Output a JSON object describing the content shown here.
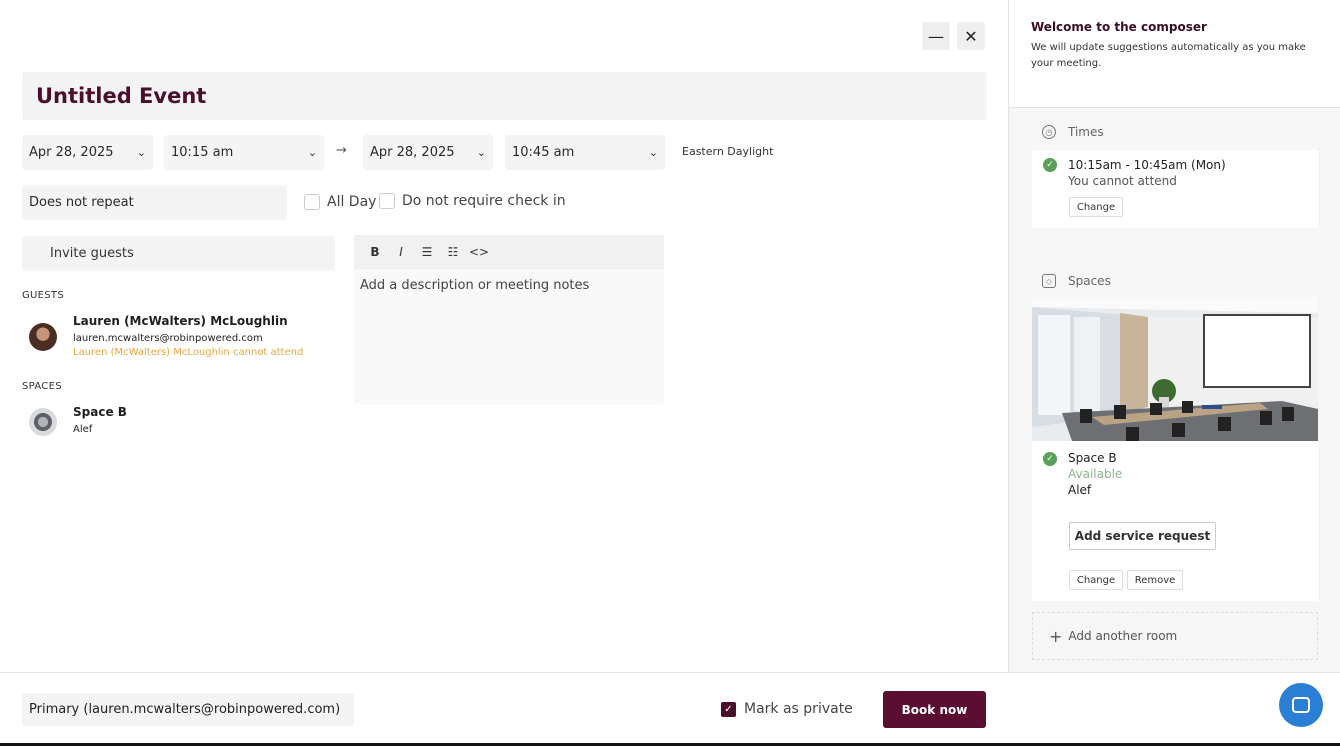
{
  "window": {
    "minimize_icon": "minimize-icon",
    "close_icon": "close-icon"
  },
  "event": {
    "title": "Untitled Event",
    "start_date": "Apr 28, 2025",
    "start_time": "10:15 am",
    "arrow": "→",
    "end_date": "Apr 28, 2025",
    "end_time": "10:45 am",
    "timezone": "Eastern Daylight",
    "repeat": "Does not repeat",
    "all_day_label": "All Day",
    "checkin_label": "Do not require check in",
    "invite_placeholder": "Invite guests",
    "description_placeholder": "Add a description or meeting notes"
  },
  "toolbar": {
    "bold": "B",
    "italic": "I",
    "code": "<>"
  },
  "guests": {
    "heading": "GUESTS",
    "items": [
      {
        "name": "Lauren (McWalters) McLoughlin",
        "email": "lauren.mcwalters@robinpowered.com",
        "warning": "Lauren (McWalters) McLoughlin cannot attend"
      }
    ]
  },
  "spaces": {
    "heading": "SPACES",
    "items": [
      {
        "name": "Space B",
        "location": "Alef"
      }
    ]
  },
  "footer": {
    "calendar": "Primary (lauren.mcwalters@robinpowered.com)",
    "private_label": "Mark as private",
    "private_checked": true,
    "book_label": "Book now"
  },
  "sidebar": {
    "welcome_title": "Welcome to the composer",
    "welcome_text": "We will update suggestions automatically as you make your meeting.",
    "times": {
      "heading": "Times",
      "range": "10:15am - 10:45am (Mon)",
      "note": "You cannot attend",
      "change_label": "Change"
    },
    "spaces": {
      "heading": "Spaces",
      "name": "Space B",
      "status": "Available",
      "location": "Alef",
      "service_label": "Add service request",
      "change_label": "Change",
      "remove_label": "Remove"
    },
    "add_room_label": "Add another room"
  },
  "colors": {
    "brand": "#5a0f32",
    "title": "#4a0f2a",
    "success": "#5aa05a",
    "warning": "#e5a93e",
    "chat": "#2a7fd4"
  }
}
